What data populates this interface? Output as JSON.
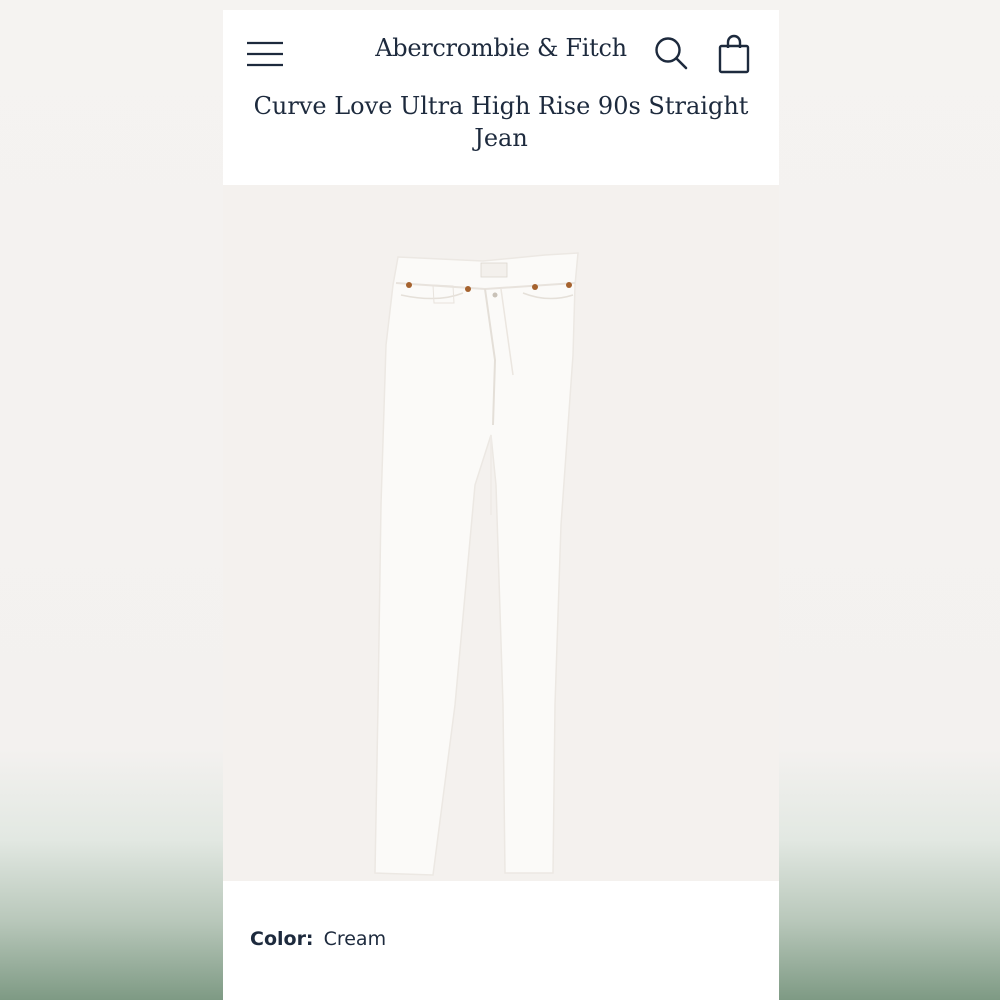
{
  "header": {
    "brand": "Abercrombie & Fitch",
    "menu_icon": "hamburger-menu-icon",
    "search_icon": "search-icon",
    "bag_icon": "shopping-bag-icon"
  },
  "product": {
    "title": "Curve Love Ultra High Rise 90s Straight Jean",
    "image_alt": "cream jeans product image",
    "color_label": "Color:",
    "color_value": "Cream"
  },
  "colors": {
    "text": "#1d2a3d",
    "background_blur": "#f3f1ef",
    "image_bg": "#f4f1ee",
    "jeans": "#fbfaf8",
    "rivets": "#a5622e",
    "footer_green": "#7e9a84"
  }
}
